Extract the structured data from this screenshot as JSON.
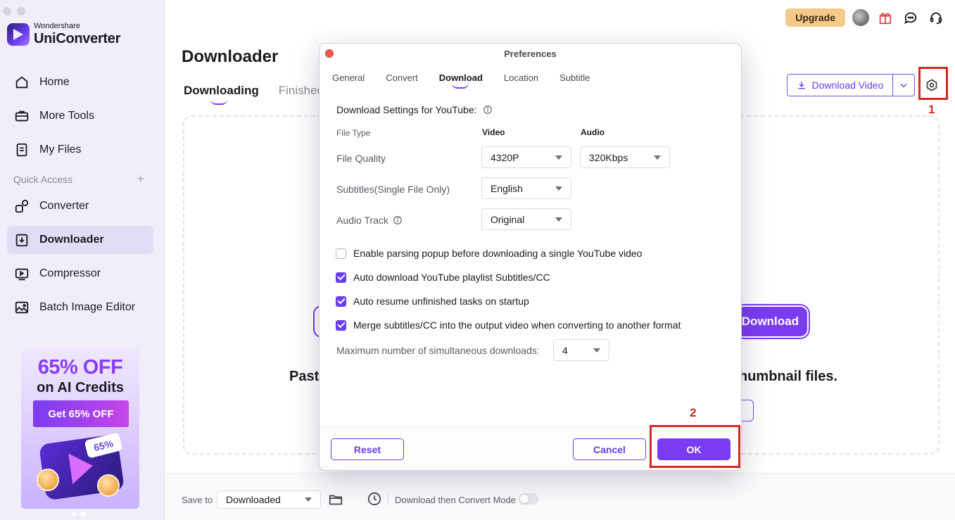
{
  "brand": {
    "small": "Wondershare",
    "name": "UniConverter"
  },
  "sidebar": {
    "items": [
      {
        "label": "Home",
        "icon": "home-icon"
      },
      {
        "label": "More Tools",
        "icon": "toolbox-icon"
      },
      {
        "label": "My Files",
        "icon": "files-icon"
      }
    ],
    "quick_access_label": "Quick Access",
    "quick_access_add": "+",
    "items2": [
      {
        "label": "Converter",
        "icon": "converter-icon"
      },
      {
        "label": "Downloader",
        "icon": "downloader-icon",
        "active": true
      },
      {
        "label": "Compressor",
        "icon": "compressor-icon"
      },
      {
        "label": "Batch Image Editor",
        "icon": "image-editor-icon"
      }
    ],
    "promo": {
      "title": "65% OFF",
      "subtitle": "on AI Credits",
      "button": "Get 65% OFF",
      "tag": "65%",
      "coin_label": "AI"
    }
  },
  "topbar": {
    "upgrade": "Upgrade"
  },
  "main": {
    "title": "Downloader",
    "tabs": [
      {
        "label": "Downloading"
      },
      {
        "label": "Finished"
      }
    ],
    "download_video": "Download Video",
    "bg_download": "Download",
    "bg_paste": "Past",
    "bg_thumbnail": "humbnail files."
  },
  "annotations": {
    "one": "1",
    "two": "2"
  },
  "bottombar": {
    "save_to_label": "Save to",
    "save_to_value": "Downloaded",
    "mode_label": "Download then Convert Mode"
  },
  "dialog": {
    "title": "Preferences",
    "tabs": [
      "General",
      "Convert",
      "Download",
      "Location",
      "Subtitle"
    ],
    "active_tab": "Download",
    "section_title": "Download Settings for YouTube:",
    "file_type_label": "File Type",
    "col_video": "Video",
    "col_audio": "Audio",
    "quality_label": "File Quality",
    "video_quality": "4320P",
    "audio_quality": "320Kbps",
    "subtitles_label": "Subtitles(Single File Only)",
    "subtitles_value": "English",
    "audio_track_label": "Audio Track",
    "audio_track_value": "Original",
    "checkboxes": [
      {
        "label": "Enable parsing popup before downloading a single YouTube video",
        "checked": false
      },
      {
        "label": "Auto download YouTube playlist Subtitles/CC",
        "checked": true
      },
      {
        "label": "Auto resume unfinished tasks on startup",
        "checked": true
      },
      {
        "label": "Merge subtitles/CC into the output video when converting to another format",
        "checked": true
      }
    ],
    "max_downloads_label": "Maximum number of simultaneous downloads:",
    "max_downloads_value": "4",
    "reset": "Reset",
    "cancel": "Cancel",
    "ok": "OK"
  },
  "colors": {
    "accent": "#7a3cf2",
    "highlight": "#d42a1e",
    "upgrade": "#f4c98a"
  }
}
